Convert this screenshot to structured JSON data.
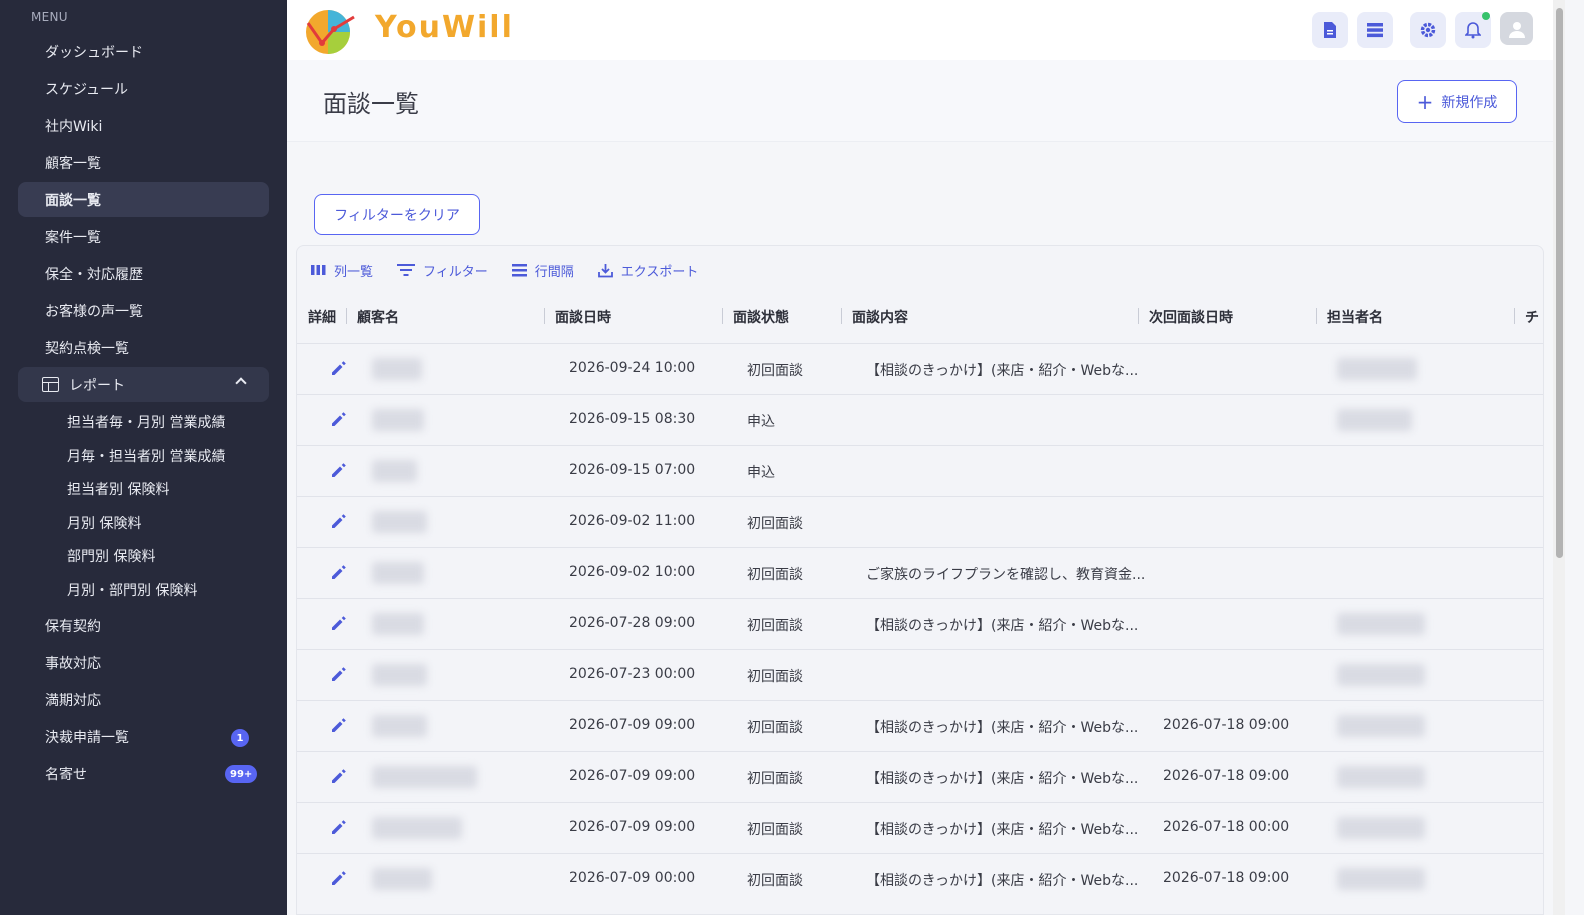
{
  "app": {
    "brand": "YouWill"
  },
  "sidebar": {
    "menu_label": "MENU",
    "items": [
      {
        "label": "ダッシュボード"
      },
      {
        "label": "スケジュール"
      },
      {
        "label": "社内Wiki"
      },
      {
        "label": "顧客一覧"
      },
      {
        "label": "面談一覧",
        "active": true
      },
      {
        "label": "案件一覧"
      },
      {
        "label": "保全・対応履歴"
      },
      {
        "label": "お客様の声一覧"
      },
      {
        "label": "契約点検一覧"
      }
    ],
    "report_group": {
      "label": "レポート",
      "children": [
        {
          "label": "担当者毎・月別 営業成績"
        },
        {
          "label": "月毎・担当者別 営業成績"
        },
        {
          "label": "担当者別 保険料"
        },
        {
          "label": "月別 保険料"
        },
        {
          "label": "部門別 保険料"
        },
        {
          "label": "月別・部門別 保険料"
        }
      ]
    },
    "items_after": [
      {
        "label": "保有契約"
      },
      {
        "label": "事故対応"
      },
      {
        "label": "満期対応"
      },
      {
        "label": "決裁申請一覧",
        "badge": "1"
      },
      {
        "label": "名寄せ",
        "badge": "99+"
      }
    ]
  },
  "header": {
    "icons": [
      "document-icon",
      "list-icon",
      "gear-icon",
      "bell-icon",
      "avatar-icon"
    ]
  },
  "page": {
    "title": "面談一覧",
    "new_button": "新規作成",
    "clear_filter_button": "フィルターをクリア"
  },
  "toolbar": {
    "columns": "列一覧",
    "filter": "フィルター",
    "density": "行間隔",
    "export": "エクスポート"
  },
  "table": {
    "headers": [
      "詳細",
      "顧客名",
      "面談日時",
      "面談状態",
      "面談内容",
      "次回面談日時",
      "担当者名",
      "チ"
    ],
    "rows": [
      {
        "date": "2026-09-24 10:00",
        "status": "初回面談",
        "content": "【相談のきっかけ】(来店・紹介・Webな...",
        "next": ""
      },
      {
        "date": "2026-09-15 08:30",
        "status": "申込",
        "content": "",
        "next": ""
      },
      {
        "date": "2026-09-15 07:00",
        "status": "申込",
        "content": "",
        "next": ""
      },
      {
        "date": "2026-09-02 11:00",
        "status": "初回面談",
        "content": "",
        "next": ""
      },
      {
        "date": "2026-09-02 10:00",
        "status": "初回面談",
        "content": "ご家族のライフプランを確認し、教育資金...",
        "next": ""
      },
      {
        "date": "2026-07-28 09:00",
        "status": "初回面談",
        "content": "【相談のきっかけ】(来店・紹介・Webな...",
        "next": ""
      },
      {
        "date": "2026-07-23 00:00",
        "status": "初回面談",
        "content": "",
        "next": ""
      },
      {
        "date": "2026-07-09 09:00",
        "status": "初回面談",
        "content": "【相談のきっかけ】(来店・紹介・Webな...",
        "next": "2026-07-18 09:00"
      },
      {
        "date": "2026-07-09 09:00",
        "status": "初回面談",
        "content": "【相談のきっかけ】(来店・紹介・Webな...",
        "next": "2026-07-18 09:00"
      },
      {
        "date": "2026-07-09 09:00",
        "status": "初回面談",
        "content": "【相談のきっかけ】(来店・紹介・Webな...",
        "next": "2026-07-18 00:00"
      },
      {
        "date": "2026-07-09 00:00",
        "status": "初回面談",
        "content": "【相談のきっかけ】(来店・紹介・Webな...",
        "next": "2026-07-18 09:00"
      }
    ]
  },
  "colors": {
    "sidebar_bg": "#272a3b",
    "accent": "#5865f2",
    "brand_orange": "#f2a82d"
  }
}
